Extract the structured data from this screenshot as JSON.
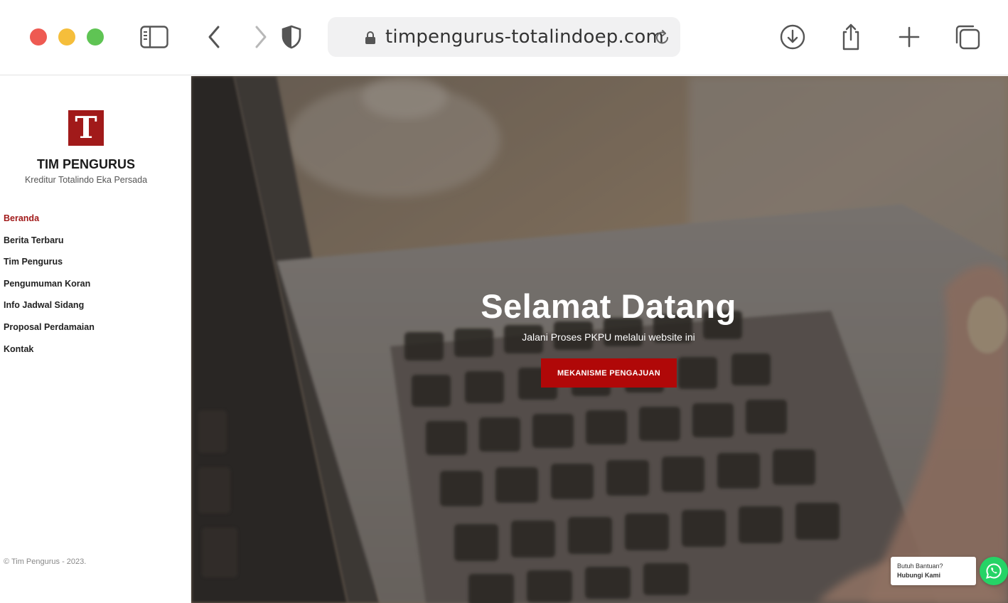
{
  "browser": {
    "url": "timpengurus-totalindoep.com"
  },
  "sidebar": {
    "logo_letter": "T",
    "brand_title": "TIM PENGURUS",
    "brand_subtitle": "Kreditur Totalindo Eka Persada",
    "nav": [
      {
        "label": "Beranda",
        "active": true
      },
      {
        "label": "Berita Terbaru",
        "active": false
      },
      {
        "label": "Tim Pengurus",
        "active": false
      },
      {
        "label": "Pengumuman Koran",
        "active": false
      },
      {
        "label": "Info Jadwal Sidang",
        "active": false
      },
      {
        "label": "Proposal Perdamaian",
        "active": false
      },
      {
        "label": "Kontak",
        "active": false
      }
    ],
    "copyright": "© Tim Pengurus - 2023."
  },
  "hero": {
    "title": "Selamat Datang",
    "subtitle": "Jalani Proses PKPU melalui website ini",
    "button_label": "MEKANISME PENGAJUAN"
  },
  "help": {
    "text": "Butuh Bantuan?",
    "link": "Hubungi Kami"
  },
  "colors": {
    "brand": "#a11a1a",
    "button": "#b00808",
    "whatsapp": "#25d366"
  }
}
